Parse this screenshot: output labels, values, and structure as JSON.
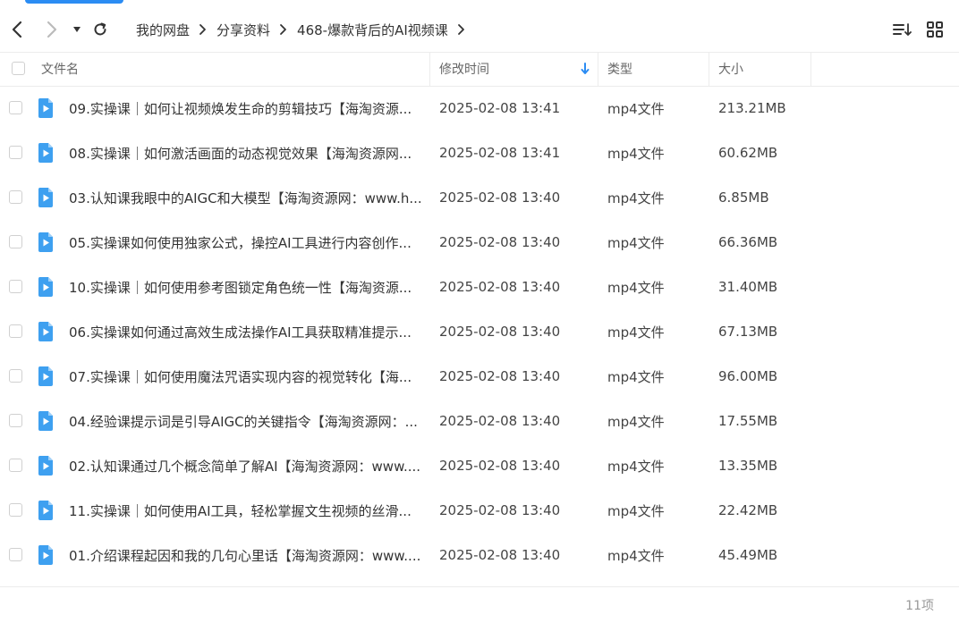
{
  "breadcrumb": {
    "items": [
      "我的网盘",
      "分享资料",
      "468-爆款背后的AI视频课"
    ]
  },
  "toolbar": {
    "back_icon": "chevron-left-icon",
    "forward_icon": "chevron-right-icon",
    "history_icon": "caret-down-icon",
    "refresh_icon": "refresh-icon",
    "sort_icon": "sort-list-icon",
    "grid_icon": "grid-view-icon"
  },
  "table": {
    "columns": {
      "name": "文件名",
      "modified": "修改时间",
      "type": "类型",
      "size": "大小"
    },
    "sort_icon": "arrow-down-icon",
    "rows": [
      {
        "name": "09.实操课｜如何让视频焕发生命的剪辑技巧【海淘资源...",
        "time": "2025-02-08 13:41",
        "type": "mp4文件",
        "size": "213.21MB"
      },
      {
        "name": "08.实操课｜如何激活画面的动态视觉效果【海淘资源网...",
        "time": "2025-02-08 13:41",
        "type": "mp4文件",
        "size": "60.62MB"
      },
      {
        "name": "03.认知课我眼中的AIGC和大模型【海淘资源网：www.h...",
        "time": "2025-02-08 13:40",
        "type": "mp4文件",
        "size": "6.85MB"
      },
      {
        "name": "05.实操课如何使用独家公式，操控AI工具进行内容创作...",
        "time": "2025-02-08 13:40",
        "type": "mp4文件",
        "size": "66.36MB"
      },
      {
        "name": "10.实操课｜如何使用参考图锁定角色统一性【海淘资源...",
        "time": "2025-02-08 13:40",
        "type": "mp4文件",
        "size": "31.40MB"
      },
      {
        "name": "06.实操课如何通过高效生成法操作AI工具获取精准提示...",
        "time": "2025-02-08 13:40",
        "type": "mp4文件",
        "size": "67.13MB"
      },
      {
        "name": "07.实操课｜如何使用魔法咒语实现内容的视觉转化【海...",
        "time": "2025-02-08 13:40",
        "type": "mp4文件",
        "size": "96.00MB"
      },
      {
        "name": "04.经验课提示词是引导AIGC的关键指令【海淘资源网：...",
        "time": "2025-02-08 13:40",
        "type": "mp4文件",
        "size": "17.55MB"
      },
      {
        "name": "02.认知课通过几个概念简单了解AI【海淘资源网：www....",
        "time": "2025-02-08 13:40",
        "type": "mp4文件",
        "size": "13.35MB"
      },
      {
        "name": "11.实操课｜如何使用AI工具，轻松掌握文生视频的丝滑...",
        "time": "2025-02-08 13:40",
        "type": "mp4文件",
        "size": "22.42MB"
      },
      {
        "name": "01.介绍课程起因和我的几句心里话【海淘资源网：www....",
        "time": "2025-02-08 13:40",
        "type": "mp4文件",
        "size": "45.49MB"
      }
    ]
  },
  "footer": {
    "count": "11项"
  },
  "colors": {
    "accent": "#2b8cf3",
    "video_icon": "#3ea0f0"
  }
}
